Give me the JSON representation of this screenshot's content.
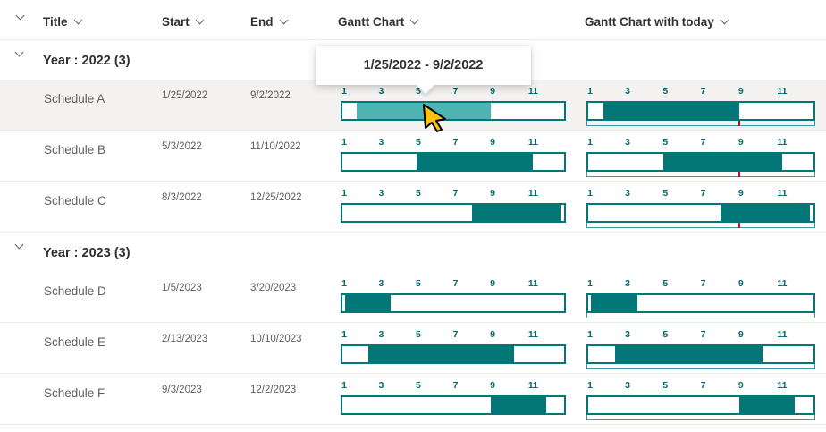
{
  "header": {
    "title": "Title",
    "start": "Start",
    "end": "End",
    "gantt": "Gantt Chart",
    "gantt_today": "Gantt Chart with today"
  },
  "month_ticks": [
    "1",
    "3",
    "5",
    "7",
    "9",
    "11"
  ],
  "groups": [
    {
      "label": "Year : 2022 (3)",
      "rows": [
        {
          "title": "Schedule A",
          "start": "1/25/2022",
          "end": "9/2/2022",
          "selected": true,
          "hover": true,
          "start_frac": 0.0656,
          "end_frac": 0.6694
        },
        {
          "title": "Schedule B",
          "start": "5/3/2022",
          "end": "11/10/2022",
          "selected": false,
          "hover": false,
          "start_frac": 0.3342,
          "end_frac": 0.8603
        },
        {
          "title": "Schedule C",
          "start": "8/3/2022",
          "end": "12/25/2022",
          "selected": false,
          "hover": false,
          "start_frac": 0.5863,
          "end_frac": 0.9836
        }
      ]
    },
    {
      "label": "Year : 2023 (3)",
      "rows": [
        {
          "title": "Schedule D",
          "start": "1/5/2023",
          "end": "3/20/2023",
          "selected": false,
          "hover": false,
          "start_frac": 0.011,
          "end_frac": 0.2164
        },
        {
          "title": "Schedule E",
          "start": "2/13/2023",
          "end": "10/10/2023",
          "selected": false,
          "hover": false,
          "start_frac": 0.1178,
          "end_frac": 0.7726
        },
        {
          "title": "Schedule F",
          "start": "9/3/2023",
          "end": "12/2/2023",
          "selected": false,
          "hover": false,
          "start_frac": 0.6712,
          "end_frac": 0.9178
        }
      ]
    }
  ],
  "today_frac_2022": 0.665,
  "tooltip": {
    "text": "1/25/2022 - 9/2/2022"
  },
  "colors": {
    "bar": "#037777",
    "bar_hover": "#4fb3b6",
    "today": "#c50f1f",
    "tick": "#046a6a"
  }
}
